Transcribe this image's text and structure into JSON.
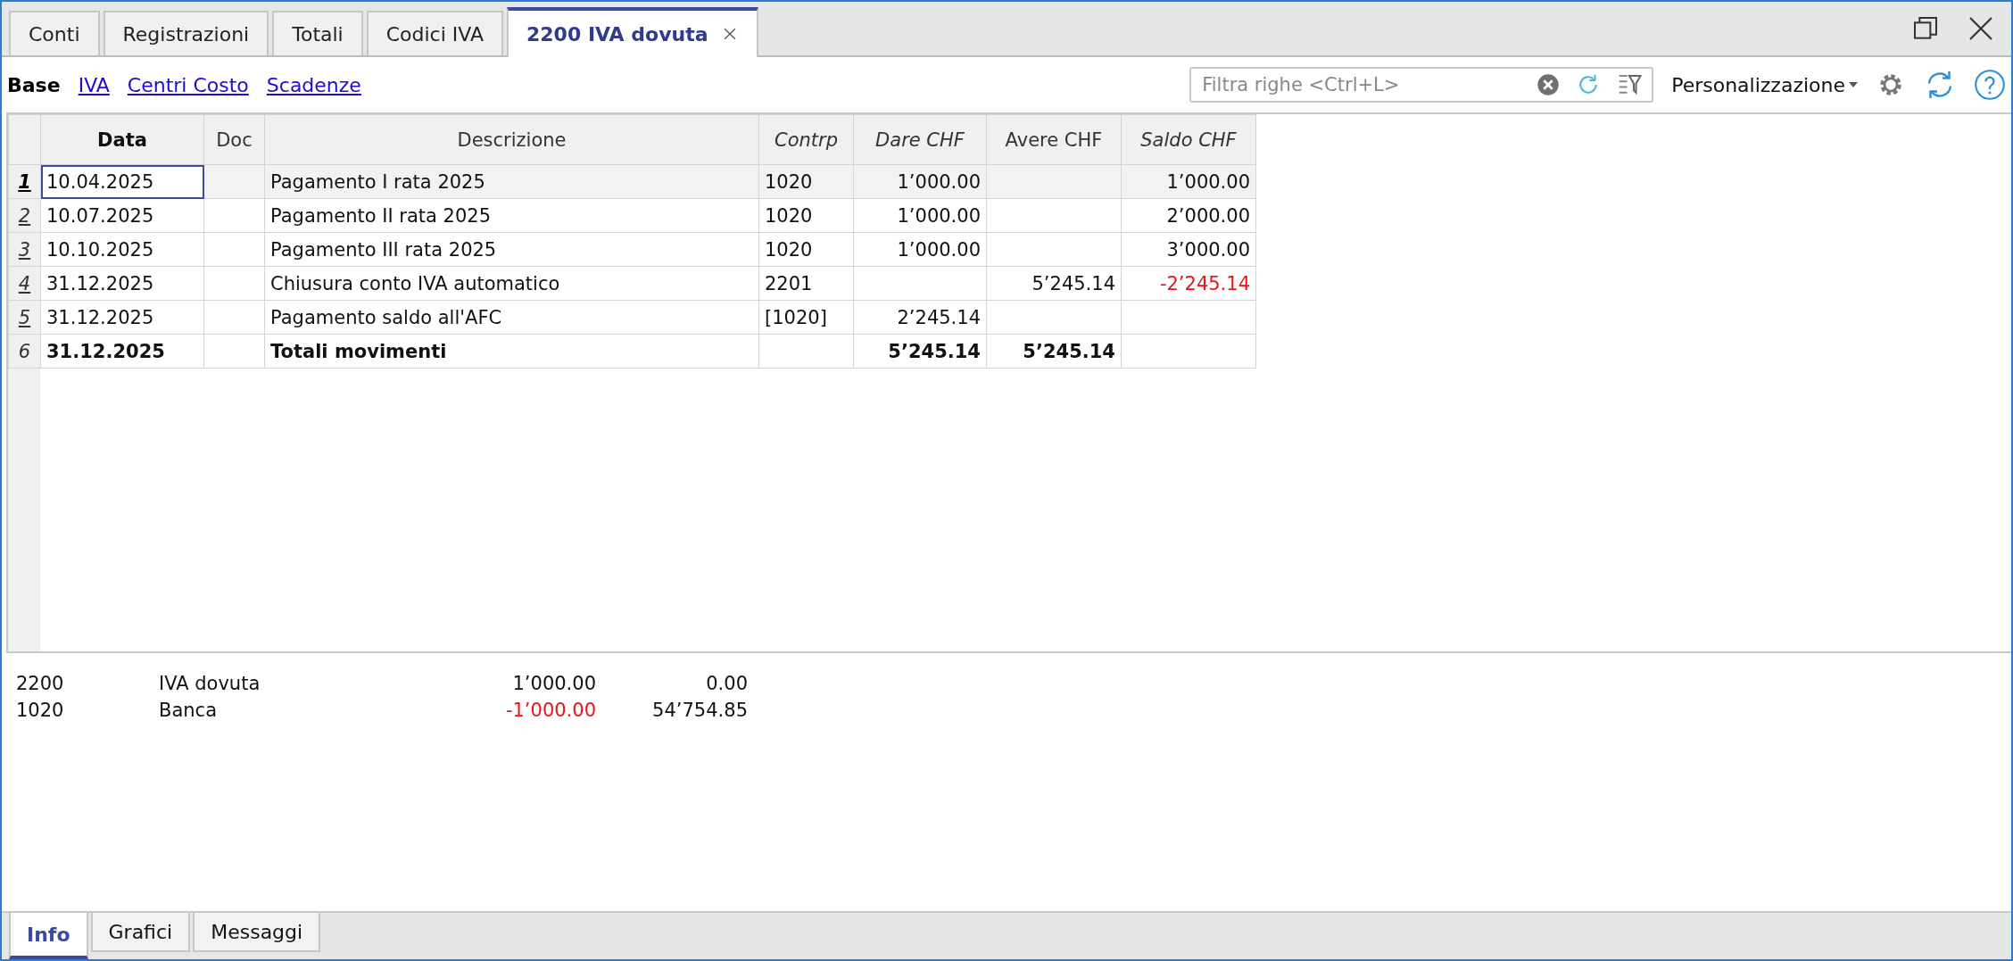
{
  "tabs": [
    {
      "label": "Conti",
      "selected": false
    },
    {
      "label": "Registrazioni",
      "selected": false
    },
    {
      "label": "Totali",
      "selected": false
    },
    {
      "label": "Codici IVA",
      "selected": false
    },
    {
      "label": "2200 IVA dovuta",
      "selected": true
    }
  ],
  "views": [
    {
      "label": "Base",
      "selected": true
    },
    {
      "label": "IVA",
      "selected": false
    },
    {
      "label": "Centri Costo",
      "selected": false
    },
    {
      "label": "Scadenze",
      "selected": false
    }
  ],
  "filter": {
    "placeholder": "Filtra righe <Ctrl+L>"
  },
  "customize": {
    "label": "Personalizzazione"
  },
  "table": {
    "columns": [
      {
        "label": "Data",
        "kind": "bold"
      },
      {
        "label": "Doc",
        "kind": "normal"
      },
      {
        "label": "Descrizione",
        "kind": "normal"
      },
      {
        "label": "Contrp",
        "kind": "italic"
      },
      {
        "label": "Dare CHF",
        "kind": "italic"
      },
      {
        "label": "Avere CHF",
        "kind": "normal"
      },
      {
        "label": "Saldo CHF",
        "kind": "italic"
      }
    ],
    "rows": [
      {
        "number": "1",
        "kind": "entry",
        "current": true,
        "date": "10.04.2025",
        "description": "Pagamento I rata 2025",
        "contra": "1020",
        "debit": "1’000.00",
        "balance": "1’000.00",
        "balance_negative": false
      },
      {
        "number": "2",
        "kind": "entry",
        "current": false,
        "date": "10.07.2025",
        "description": "Pagamento II rata 2025",
        "contra": "1020",
        "debit": "1’000.00",
        "balance": "2’000.00",
        "balance_negative": false
      },
      {
        "number": "3",
        "kind": "entry",
        "current": false,
        "date": "10.10.2025",
        "description": "Pagamento III rata 2025",
        "contra": "1020",
        "debit": "1’000.00",
        "balance": "3’000.00",
        "balance_negative": false
      },
      {
        "number": "4",
        "kind": "entry",
        "current": false,
        "date": "31.12.2025",
        "description": "Chiusura conto IVA automatico",
        "contra": "2201",
        "credit": "5’245.14",
        "balance": "-2’245.14",
        "balance_negative": true
      },
      {
        "number": "5",
        "kind": "entry",
        "current": false,
        "date": "31.12.2025",
        "description": "Pagamento saldo all'AFC",
        "contra": "[1020]",
        "debit": "2’245.14"
      },
      {
        "number": "6",
        "kind": "total",
        "current": false,
        "date": "31.12.2025",
        "description": "Totali movimenti",
        "debit": "5’245.14",
        "credit": "5’245.14"
      }
    ]
  },
  "info": [
    {
      "code": "2200",
      "name": "IVA dovuta",
      "amount": "1’000.00",
      "amount_negative": false,
      "balance": "0.00"
    },
    {
      "code": "1020",
      "name": "Banca",
      "amount": "-1’000.00",
      "amount_negative": true,
      "balance": "54’754.85"
    }
  ],
  "bottom_tabs": [
    {
      "label": "Info",
      "selected": true
    },
    {
      "label": "Grafici",
      "selected": false
    },
    {
      "label": "Messaggi",
      "selected": false
    }
  ]
}
